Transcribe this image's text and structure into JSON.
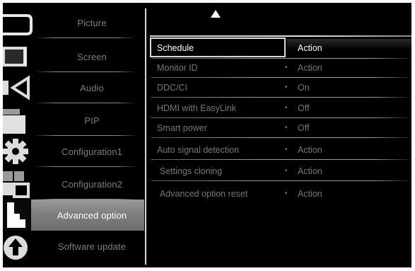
{
  "sidebar": {
    "items": [
      {
        "label": "Picture",
        "icon": "picture-icon"
      },
      {
        "label": "Screen",
        "icon": "screen-icon"
      },
      {
        "label": "Audio",
        "icon": "speaker-icon"
      },
      {
        "label": "PIP",
        "icon": "pip-icon"
      },
      {
        "label": "Configuration1",
        "icon": "gear-icon"
      },
      {
        "label": "Configuration2",
        "icon": "configuration2-icon"
      },
      {
        "label": "Advanced option",
        "icon": "advanced-option-icon",
        "selected": true
      },
      {
        "label": "Software update",
        "icon": "software-update-icon"
      }
    ]
  },
  "list": {
    "scroll_up_icon": "up-arrow-icon",
    "rows": [
      {
        "name": "Schedule",
        "value": "Action",
        "selected": true
      },
      {
        "name": "Monitor ID",
        "value": "Action"
      },
      {
        "name": "DDC/CI",
        "value": "On"
      },
      {
        "name": "HDMI with EasyLink",
        "value": "Off"
      },
      {
        "name": "Smart power",
        "value": "Off"
      },
      {
        "name": "Auto signal detection",
        "value": "Action"
      },
      {
        "name": "Settings cloning",
        "value": "Action"
      },
      {
        "name": "Advanced option reset",
        "value": "Action"
      }
    ],
    "bullet": "•"
  },
  "colors": {
    "background": "#000000",
    "inactive_text": "#777777",
    "active_text": "#ffffff",
    "selected_sidebar": "#8a8a8a"
  }
}
